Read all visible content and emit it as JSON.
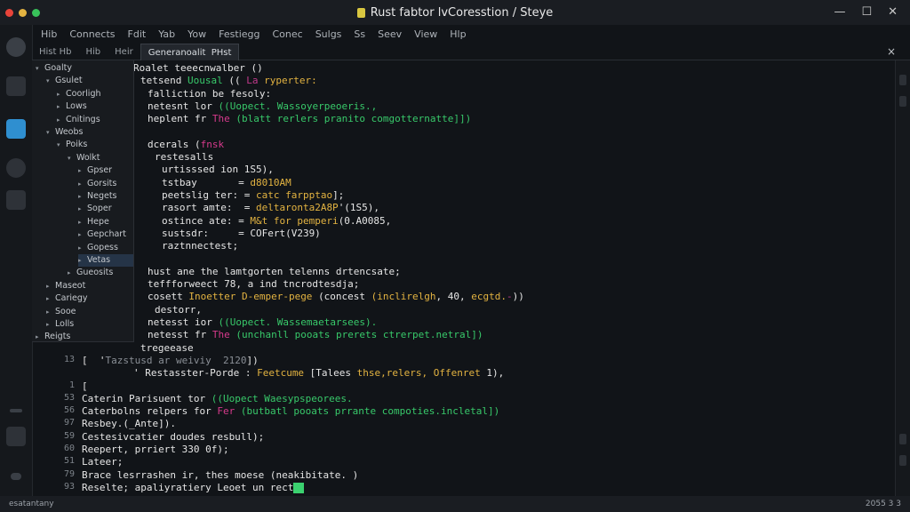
{
  "window": {
    "title": "Rust fabtor lvCoresstion / Steye",
    "controls": [
      "—",
      "☐",
      "✕"
    ]
  },
  "menu": [
    "Hib",
    "Connects",
    "Fdit",
    "Yab",
    "Yow",
    "Festiegg",
    "Conec",
    "Sulgs",
    "Ss",
    "Seev",
    "View",
    "Hlp"
  ],
  "tabs": [
    {
      "label": "Hist Hb",
      "active": false
    },
    {
      "label": "Hib",
      "active": false
    },
    {
      "label": "Heir",
      "active": false
    },
    {
      "label": "Generanoalit  PHst",
      "active": true
    }
  ],
  "tab_close": "×",
  "sidebar": [
    {
      "label": "Goalty",
      "depth": 0,
      "caret": "▾",
      "selected": false
    },
    {
      "label": "Gsulet",
      "depth": 1,
      "caret": "▾",
      "selected": false
    },
    {
      "label": "Coorligh",
      "depth": 2,
      "caret": "▸",
      "selected": false
    },
    {
      "label": "Lows",
      "depth": 2,
      "caret": "▸",
      "selected": false
    },
    {
      "label": "Cnitings",
      "depth": 2,
      "caret": "▸",
      "selected": false
    },
    {
      "label": "Weobs",
      "depth": 1,
      "caret": "▾",
      "selected": false
    },
    {
      "label": "Poiks",
      "depth": 2,
      "caret": "▾",
      "selected": false
    },
    {
      "label": "Wolkt",
      "depth": 3,
      "caret": "▾",
      "selected": false
    },
    {
      "label": "Gpser",
      "depth": 4,
      "caret": "▸",
      "selected": false
    },
    {
      "label": "Gorsits",
      "depth": 4,
      "caret": "▸",
      "selected": false
    },
    {
      "label": "Negets",
      "depth": 4,
      "caret": "▸",
      "selected": false
    },
    {
      "label": "Soper",
      "depth": 4,
      "caret": "▸",
      "selected": false
    },
    {
      "label": "Hepe",
      "depth": 4,
      "caret": "▸",
      "selected": false
    },
    {
      "label": "Gepchart",
      "depth": 4,
      "caret": "▸",
      "selected": false
    },
    {
      "label": "Gopess",
      "depth": 4,
      "caret": "▸",
      "selected": false
    },
    {
      "label": "Vetas",
      "depth": 4,
      "caret": "▸",
      "selected": true
    },
    {
      "label": "Gueosits",
      "depth": 3,
      "caret": "▸",
      "selected": false
    },
    {
      "label": "Maseot",
      "depth": 1,
      "caret": "▸",
      "selected": false
    },
    {
      "label": "Cariegy",
      "depth": 1,
      "caret": "▸",
      "selected": false
    },
    {
      "label": "Sooe",
      "depth": 1,
      "caret": "▸",
      "selected": false
    },
    {
      "label": "Lolls",
      "depth": 1,
      "caret": "▸",
      "selected": false
    },
    {
      "label": "Reigts",
      "depth": 0,
      "caret": "▸",
      "selected": false
    }
  ],
  "code": [
    {
      "ln": "",
      "indent": 0,
      "segs": [
        {
          "t": "Roalet teeecnwalber ()",
          "c": "#e6e6e6"
        }
      ]
    },
    {
      "ln": "",
      "indent": 1,
      "segs": [
        {
          "t": "tetsend ",
          "c": "#e6e6e6"
        },
        {
          "t": "Uousal",
          "c": "#38c96a"
        },
        {
          "t": " (( ",
          "c": "#e6e6e6"
        },
        {
          "t": "La",
          "c": "#c0398b"
        },
        {
          "t": " ",
          "c": "#e6e6e6"
        },
        {
          "t": "ryperter:",
          "c": "#e3b341"
        }
      ]
    },
    {
      "ln": "",
      "indent": 2,
      "segs": [
        {
          "t": "falliction be fesoly:",
          "c": "#e6e6e6"
        }
      ]
    },
    {
      "ln": "",
      "indent": 2,
      "segs": [
        {
          "t": "netesnt lor ",
          "c": "#e6e6e6"
        },
        {
          "t": "((Uopect. Wassoyerpeoeris.,",
          "c": "#38c96a"
        }
      ]
    },
    {
      "ln": "",
      "indent": 2,
      "segs": [
        {
          "t": "heplent fr ",
          "c": "#e6e6e6"
        },
        {
          "t": "The",
          "c": "#d63a8c"
        },
        {
          "t": " ",
          "c": "#e6e6e6"
        },
        {
          "t": "(blatt rerlers pranito comgotternatte]])",
          "c": "#38c96a"
        }
      ]
    },
    {
      "ln": "",
      "indent": 0,
      "segs": [
        {
          "t": "",
          "c": "#e6e6e6"
        }
      ]
    },
    {
      "ln": "",
      "indent": 2,
      "segs": [
        {
          "t": "dcerals ",
          "c": "#e6e6e6"
        },
        {
          "t": "(",
          "c": "#e6e6e6"
        },
        {
          "t": "fnsk",
          "c": "#d63a8c"
        }
      ]
    },
    {
      "ln": "",
      "indent": 3,
      "segs": [
        {
          "t": "restesalls",
          "c": "#e6e6e6"
        }
      ]
    },
    {
      "ln": "",
      "indent": 4,
      "segs": [
        {
          "t": "urtisssed ion 1S5),",
          "c": "#e6e6e6"
        }
      ]
    },
    {
      "ln": "",
      "indent": 4,
      "segs": [
        {
          "t": "tstbay       = ",
          "c": "#e6e6e6"
        },
        {
          "t": "d8010AM",
          "c": "#e3b341"
        }
      ]
    },
    {
      "ln": "",
      "indent": 4,
      "segs": [
        {
          "t": "peetslig ter: ",
          "c": "#e6e6e6"
        },
        {
          "t": "= ",
          "c": "#e6e6e6"
        },
        {
          "t": "catc farpptao",
          "c": "#e3b341"
        },
        {
          "t": "];",
          "c": "#e6e6e6"
        }
      ]
    },
    {
      "ln": "",
      "indent": 4,
      "segs": [
        {
          "t": "rasort amte:  = ",
          "c": "#e6e6e6"
        },
        {
          "t": "deltaronta2A8P",
          "c": "#e3b341"
        },
        {
          "t": "'(1S5),",
          "c": "#e6e6e6"
        }
      ]
    },
    {
      "ln": "",
      "indent": 4,
      "segs": [
        {
          "t": "ostince ate: ",
          "c": "#e6e6e6"
        },
        {
          "t": "= ",
          "c": "#e6e6e6"
        },
        {
          "t": "M&t for pemperi",
          "c": "#e3b341"
        },
        {
          "t": "(0.A0085,",
          "c": "#e6e6e6"
        }
      ]
    },
    {
      "ln": "",
      "indent": 4,
      "segs": [
        {
          "t": "sustsdr:     = COFert(V239)",
          "c": "#e6e6e6"
        }
      ]
    },
    {
      "ln": "",
      "indent": 4,
      "segs": [
        {
          "t": "raztnnectest;",
          "c": "#e6e6e6"
        }
      ]
    },
    {
      "ln": "",
      "indent": 0,
      "segs": [
        {
          "t": "",
          "c": "#e6e6e6"
        }
      ]
    },
    {
      "ln": "",
      "indent": 2,
      "segs": [
        {
          "t": "hust ane the lamtgorten telenns drtencsate;",
          "c": "#e6e6e6"
        }
      ]
    },
    {
      "ln": "",
      "indent": 2,
      "segs": [
        {
          "t": "teffforweect 78, a ind tncrodtesdja;",
          "c": "#e6e6e6"
        }
      ]
    },
    {
      "ln": "",
      "indent": 2,
      "segs": [
        {
          "t": "cosett ",
          "c": "#e6e6e6"
        },
        {
          "t": "Inoetter D-emper-pege ",
          "c": "#e3b341"
        },
        {
          "t": "(concest ",
          "c": "#e6e6e6"
        },
        {
          "t": "(inclirelgh",
          "c": "#e3b341"
        },
        {
          "t": ", 40, ",
          "c": "#e6e6e6"
        },
        {
          "t": "ecgtd.",
          "c": "#e3b341"
        },
        {
          "t": "-",
          "c": "#c0398b"
        },
        {
          "t": "))",
          "c": "#e6e6e6"
        }
      ]
    },
    {
      "ln": "",
      "indent": 3,
      "segs": [
        {
          "t": "destorr,",
          "c": "#e6e6e6"
        }
      ]
    },
    {
      "ln": "",
      "indent": 2,
      "segs": [
        {
          "t": "netesst ior ",
          "c": "#e6e6e6"
        },
        {
          "t": "((Uopect. Wassemaetarsees).",
          "c": "#38c96a"
        }
      ]
    },
    {
      "ln": "",
      "indent": 2,
      "segs": [
        {
          "t": "netesst fr ",
          "c": "#e6e6e6"
        },
        {
          "t": "The",
          "c": "#d63a8c"
        },
        {
          "t": " ",
          "c": "#e6e6e6"
        },
        {
          "t": "(unchanll pooats prerets ctrerpet.netral])",
          "c": "#38c96a"
        }
      ]
    },
    {
      "ln": "",
      "indent": 1,
      "segs": [
        {
          "t": "tregeease",
          "c": "#e6e6e6"
        }
      ]
    },
    {
      "ln": "13",
      "indent": 0,
      "segs": [
        {
          "t": "[  '",
          "c": "#e6e6e6"
        },
        {
          "t": "Tazstusd ar weiviy  2120",
          "c": "#8a8f96"
        },
        {
          "t": "])",
          "c": "#e6e6e6"
        }
      ]
    },
    {
      "ln": "",
      "indent": 0,
      "segs": [
        {
          "t": "' Restasster-Porde : ",
          "c": "#e6e6e6"
        },
        {
          "t": "Feetcume",
          "c": "#e3b341"
        },
        {
          "t": " [Talees ",
          "c": "#e6e6e6"
        },
        {
          "t": "thse,relers, Offenret",
          "c": "#e3b341"
        },
        {
          "t": " 1),",
          "c": "#e6e6e6"
        }
      ]
    },
    {
      "ln": "1",
      "indent": 0,
      "segs": [
        {
          "t": "[",
          "c": "#e6e6e6"
        }
      ]
    },
    {
      "ln": "53",
      "indent": 0,
      "segs": [
        {
          "t": "Caterin Parisuent tor ",
          "c": "#e6e6e6"
        },
        {
          "t": "((Uopect Waesypspeorees.",
          "c": "#38c96a"
        }
      ]
    },
    {
      "ln": "56",
      "indent": 0,
      "segs": [
        {
          "t": "Caterbolns relpers for ",
          "c": "#e6e6e6"
        },
        {
          "t": "Fer",
          "c": "#d63a8c"
        },
        {
          "t": " ",
          "c": "#e6e6e6"
        },
        {
          "t": "(butbatl pooats prrante compoties.incletal])",
          "c": "#38c96a"
        }
      ]
    },
    {
      "ln": "97",
      "indent": 0,
      "segs": [
        {
          "t": "Resbey.(_Ante]).",
          "c": "#e6e6e6"
        }
      ]
    },
    {
      "ln": "59",
      "indent": 0,
      "segs": [
        {
          "t": "Cestesivcatier doudes resbull);",
          "c": "#e6e6e6"
        }
      ]
    },
    {
      "ln": "60",
      "indent": 0,
      "segs": [
        {
          "t": "Reepert, prriert 330 0f);",
          "c": "#e6e6e6"
        }
      ]
    },
    {
      "ln": "51",
      "indent": 0,
      "segs": [
        {
          "t": "Lateer;",
          "c": "#e6e6e6"
        }
      ]
    },
    {
      "ln": "79",
      "indent": 0,
      "segs": [
        {
          "t": "Brace lesrrashen ir, thes moese (neakibitate. )",
          "c": "#e6e6e6"
        }
      ]
    },
    {
      "ln": "93",
      "indent": 0,
      "segs": [
        {
          "t": "Reselte; apaliyratiery Leoet un rect",
          "c": "#e6e6e6"
        }
      ],
      "cursor": true
    }
  ],
  "status": {
    "left": "esatantany",
    "right": "2055 3 3"
  }
}
